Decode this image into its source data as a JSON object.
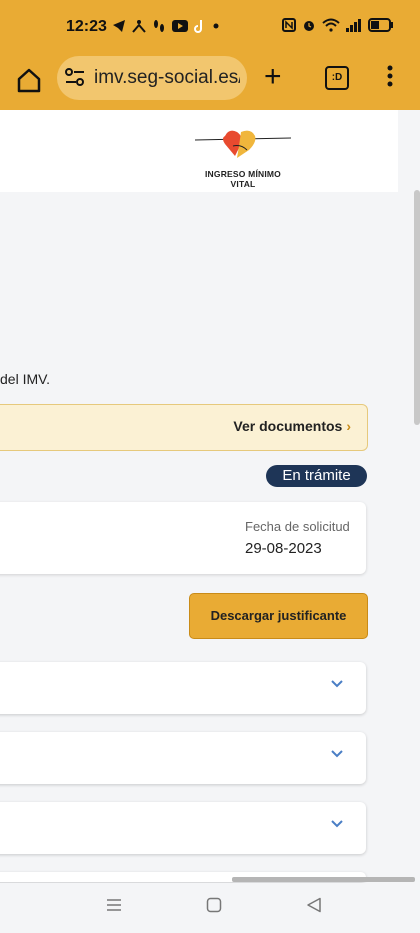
{
  "status_bar": {
    "time": "12:23",
    "icons": [
      "telegram-icon",
      "people-icon",
      "footprints-icon",
      "youtube-icon",
      "tiktok-icon",
      "dot-icon"
    ],
    "right_icons": [
      "nfc-icon",
      "alarm-icon",
      "wifi-icon",
      "signal-icon",
      "battery-icon"
    ]
  },
  "browser": {
    "url": "imv.seg-social.es/",
    "tabs_label": ":D"
  },
  "header": {
    "logo_text": "INGRESO MÍNIMO VITAL"
  },
  "content": {
    "intro_text": "del IMV.",
    "docs_link_label": "Ver documentos",
    "status_badge": "En trámite",
    "date_label": "Fecha de solicitud",
    "date_value": "29-08-2023",
    "download_button": "Descargar justificante"
  },
  "accordions": [
    "",
    "",
    ""
  ],
  "colors": {
    "brand": "#e9ab34",
    "badge": "#1e3557",
    "banner": "#fbf1d4",
    "chevron": "#4a7ec5"
  }
}
